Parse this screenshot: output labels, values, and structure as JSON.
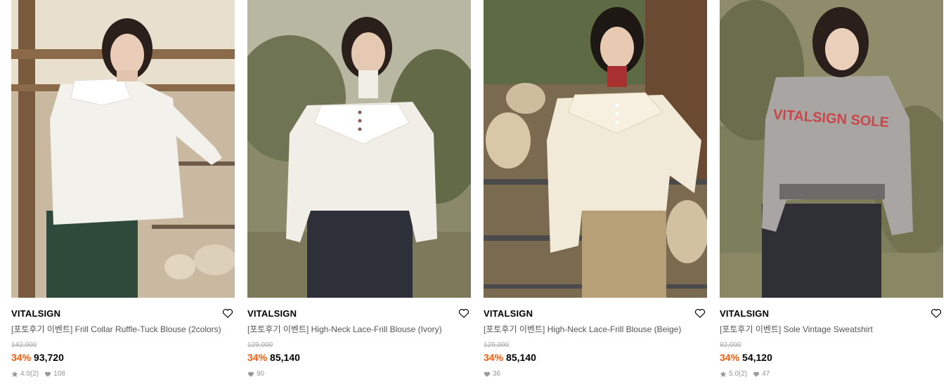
{
  "products": [
    {
      "brand": "VITALSIGN",
      "name": "[포토후기 이벤트] Frill Collar Ruffle-Tuck Blouse (2colors)",
      "original_price": "142,000",
      "discount": "34%",
      "price": "93,720",
      "rating": "4.0",
      "review_count": "(2)",
      "likes": "108"
    },
    {
      "brand": "VITALSIGN",
      "name": "[포토후기 이벤트] High-Neck Lace-Frill Blouse (Ivory)",
      "original_price": "129,000",
      "discount": "34%",
      "price": "85,140",
      "rating": null,
      "review_count": null,
      "likes": "90"
    },
    {
      "brand": "VITALSIGN",
      "name": "[포토후기 이벤트] High-Neck Lace-Frill Blouse (Beige)",
      "original_price": "129,000",
      "discount": "34%",
      "price": "85,140",
      "rating": null,
      "review_count": null,
      "likes": "36"
    },
    {
      "brand": "VITALSIGN",
      "name": "[포토후기 이벤트] Sole Vintage Sweatshirt",
      "original_price": "82,000",
      "discount": "34%",
      "price": "54,120",
      "rating": "5.0",
      "review_count": "(2)",
      "likes": "47",
      "print_text": "VITALSIGN SOLE"
    }
  ],
  "colors": {
    "discount": "#ff5a0a",
    "muted": "#999999",
    "strike": "#aaaaaa"
  },
  "icons": {
    "wishlist": "heart-outline-icon",
    "rating": "star-icon",
    "likes": "heart-filled-icon"
  }
}
